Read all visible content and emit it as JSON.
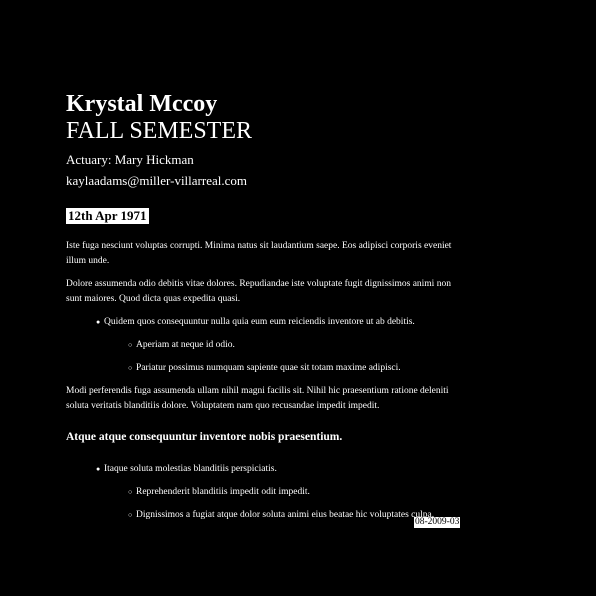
{
  "header": {
    "name": "Krystal Mccoy",
    "semester": "FALL SEMESTER",
    "actuary": "Actuary: Mary Hickman",
    "email": "kaylaadams@miller-villarreal.com"
  },
  "date_label": "12th Apr 1971",
  "paragraphs": [
    "Iste fuga nesciunt voluptas corrupti. Minima natus sit laudantium saepe. Eos adipisci corporis eveniet illum unde.",
    "Dolore assumenda odio debitis vitae dolores. Repudiandae iste voluptate fugit dignissimos animi non sunt maiores. Quod dicta quas expedita quasi.",
    "Modi perferendis fuga assumenda ullam nihil magni facilis sit. Nihil hic praesentium ratione deleniti soluta veritatis blanditiis dolore. Voluptatem nam quo recusandae impedit impedit."
  ],
  "list1": {
    "item": "Quidem quos consequuntur nulla quia eum eum reiciendis inventore ut ab debitis.",
    "subitems": [
      "Aperiam at neque id odio.",
      "Pariatur possimus numquam sapiente quae sit totam maxime adipisci."
    ]
  },
  "subheading": "Atque atque consequuntur inventore nobis praesentium.",
  "list2": {
    "item": "Itaque soluta molestias blanditiis perspiciatis.",
    "subitems": [
      "Reprehenderit blanditiis impedit odit impedit.",
      "Dignissimos a fugiat atque dolor soluta animi eius beatae hic voluptates culpa."
    ]
  },
  "footer_code": "08-2009-03",
  "colors": {
    "background": "#000000",
    "text": "#ffffff",
    "highlight": "#ffffff"
  }
}
